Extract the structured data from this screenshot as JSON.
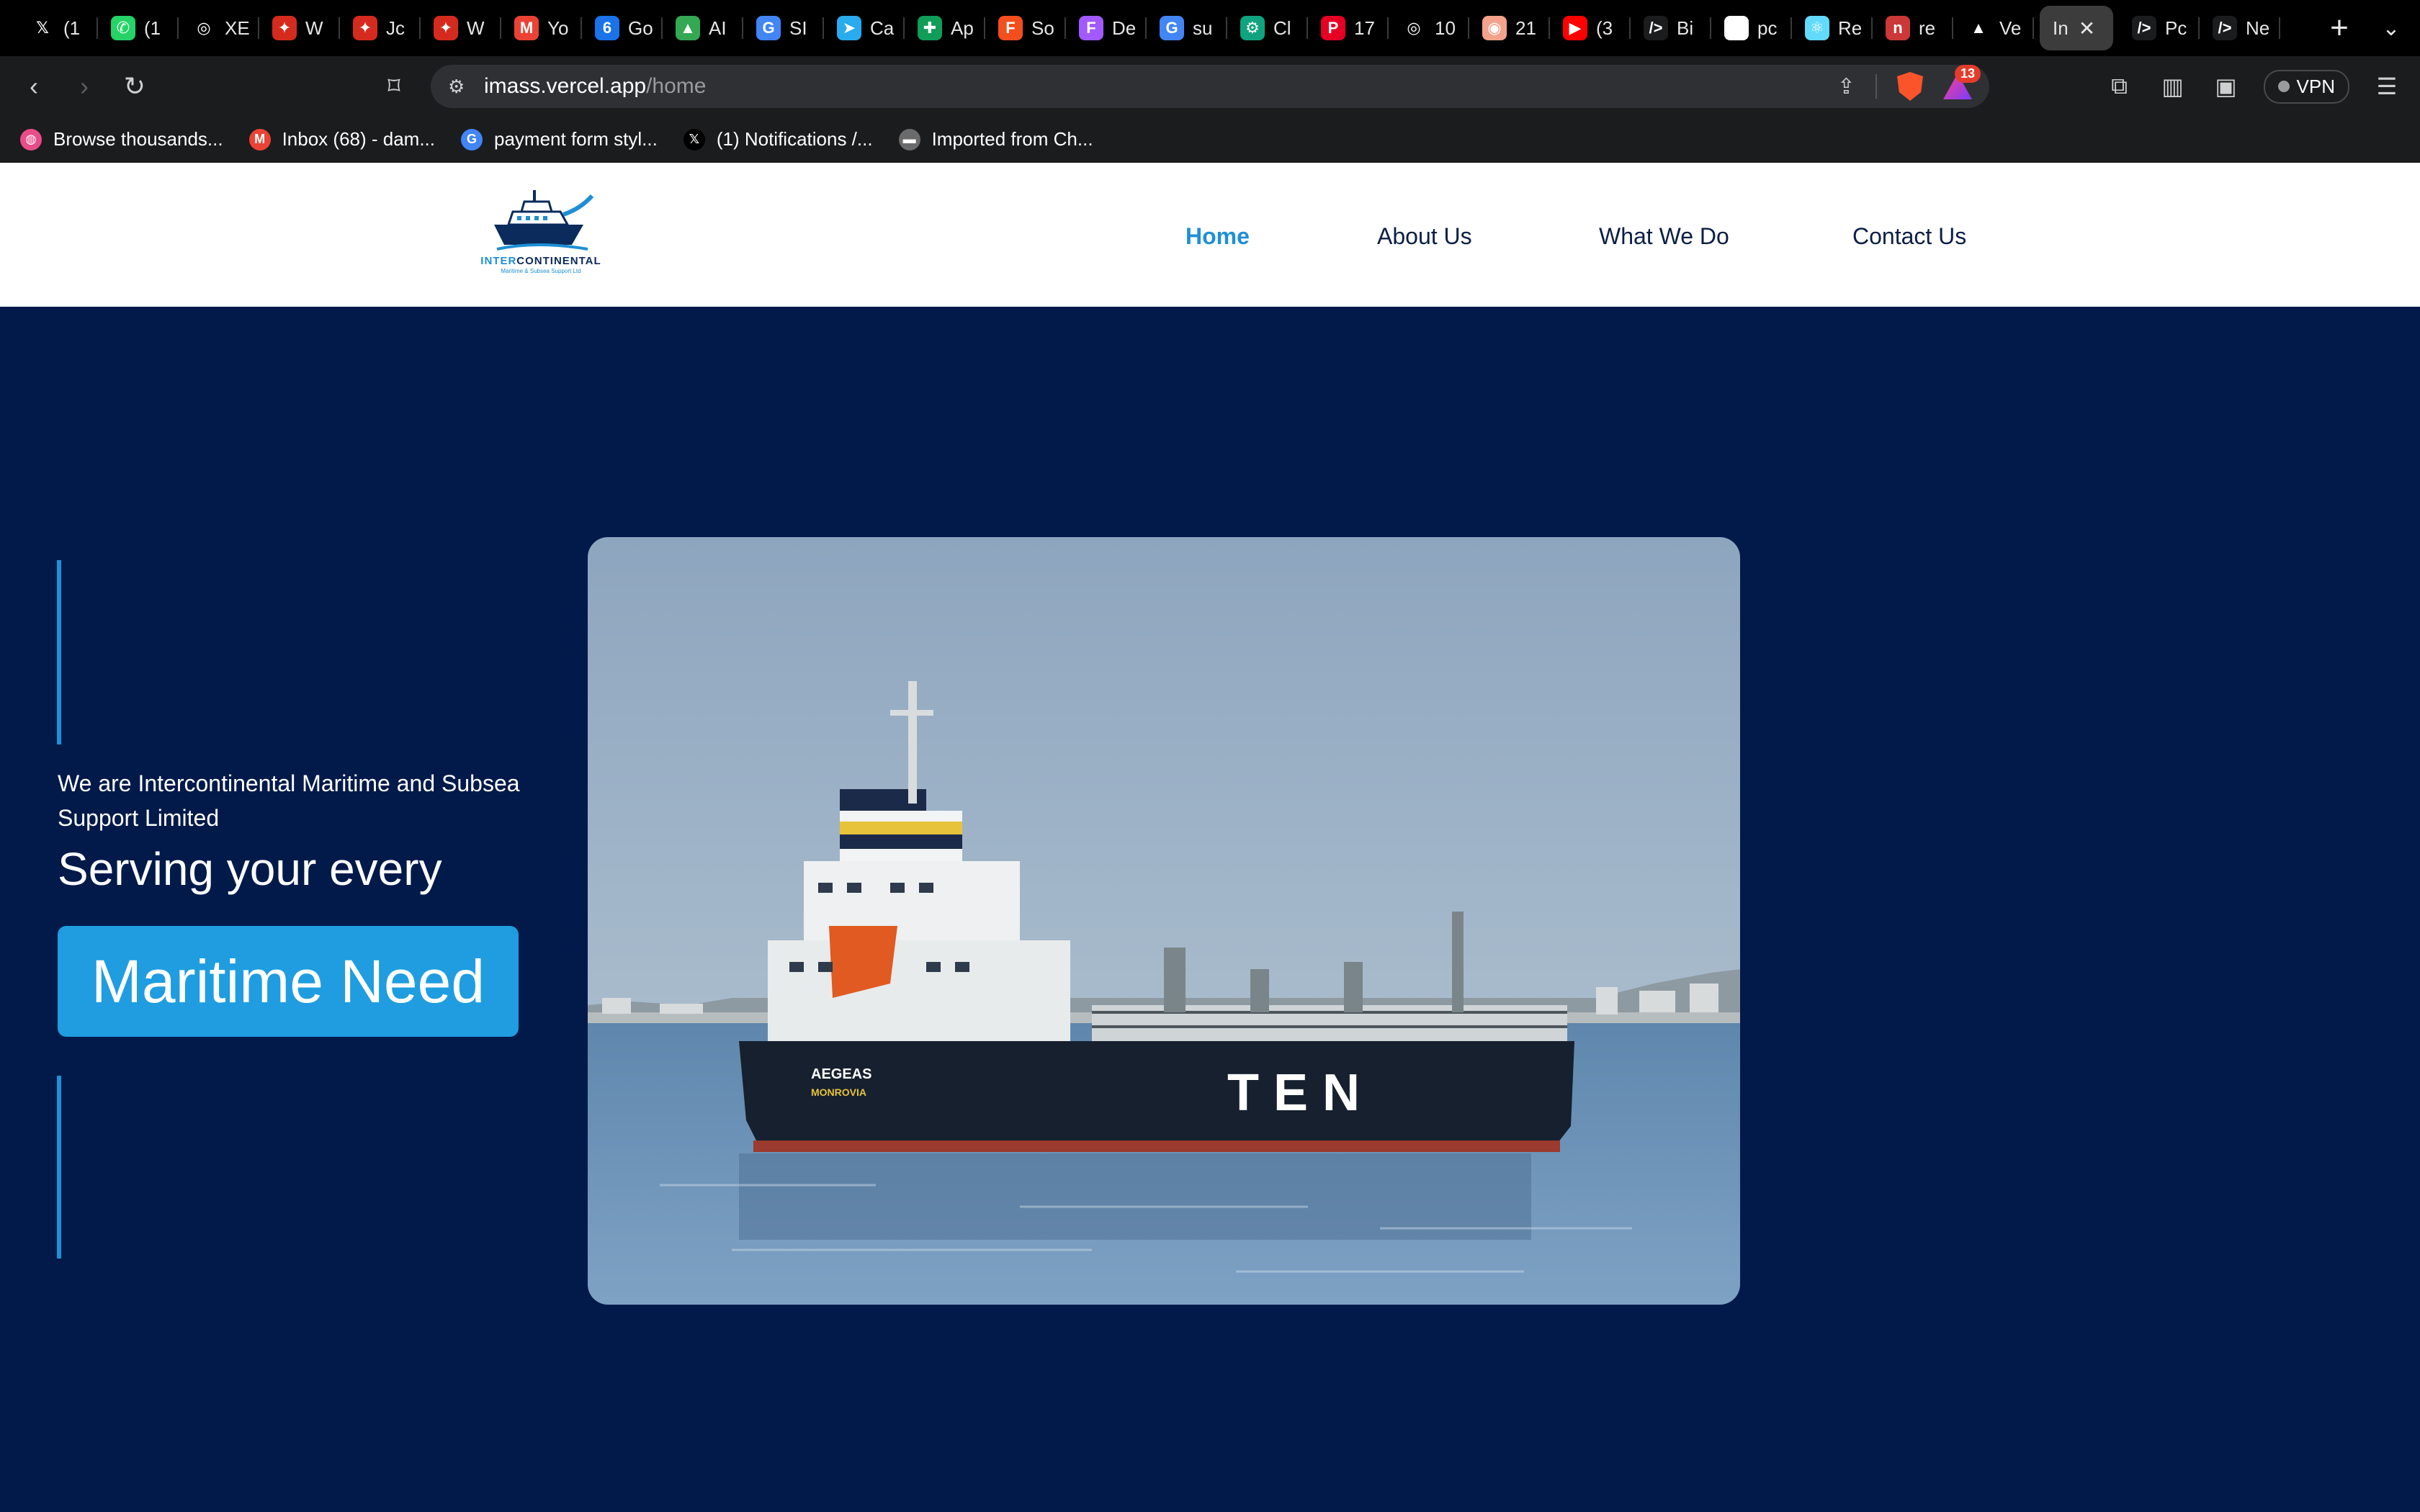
{
  "browser": {
    "tabs": [
      {
        "title": "(1",
        "icon": "x-icon",
        "color": "#000000",
        "glyph": "𝕏"
      },
      {
        "title": "(1",
        "icon": "whatsapp-icon",
        "color": "#25d366",
        "glyph": "✆"
      },
      {
        "title": "XE",
        "icon": "openai-icon",
        "color": "#000000",
        "glyph": "◎"
      },
      {
        "title": "W",
        "icon": "maple-leaf-icon",
        "color": "#d52b1e",
        "glyph": "✦"
      },
      {
        "title": "Jc",
        "icon": "maple-leaf-icon",
        "color": "#d52b1e",
        "glyph": "✦"
      },
      {
        "title": "W",
        "icon": "maple-leaf-icon",
        "color": "#d52b1e",
        "glyph": "✦"
      },
      {
        "title": "Yo",
        "icon": "gmail-icon",
        "color": "#ea4335",
        "glyph": "M"
      },
      {
        "title": "Go",
        "icon": "google-calendar-icon",
        "color": "#1a73e8",
        "glyph": "6"
      },
      {
        "title": "AI",
        "icon": "google-drive-icon",
        "color": "#34a853",
        "glyph": "▲"
      },
      {
        "title": "SI",
        "icon": "google-icon",
        "color": "#4285f4",
        "glyph": "G"
      },
      {
        "title": "Ca",
        "icon": "telegram-icon",
        "color": "#2aabee",
        "glyph": "➤"
      },
      {
        "title": "Ap",
        "icon": "google-sheets-icon",
        "color": "#0f9d58",
        "glyph": "✚"
      },
      {
        "title": "So",
        "icon": "figma-icon",
        "color": "#f24e1e",
        "glyph": "F"
      },
      {
        "title": "De",
        "icon": "figma-icon",
        "color": "#a259ff",
        "glyph": "F"
      },
      {
        "title": "su",
        "icon": "google-icon",
        "color": "#4285f4",
        "glyph": "G"
      },
      {
        "title": "Cl",
        "icon": "chatgpt-icon",
        "color": "#10a37f",
        "glyph": "⚙"
      },
      {
        "title": "17",
        "icon": "pinterest-icon",
        "color": "#e60023",
        "glyph": "P"
      },
      {
        "title": "10",
        "icon": "openai-icon",
        "color": "#000000",
        "glyph": "◎"
      },
      {
        "title": "21",
        "icon": "fingerprint-icon",
        "color": "#f4a28c",
        "glyph": "◉"
      },
      {
        "title": "(3",
        "icon": "youtube-icon",
        "color": "#ff0000",
        "glyph": "▶"
      },
      {
        "title": "Bi",
        "icon": "code-icon",
        "color": "#1b1c1e",
        "glyph": "/>"
      },
      {
        "title": "pc",
        "icon": "github-icon",
        "color": "#ffffff",
        "glyph": "◐"
      },
      {
        "title": "Re",
        "icon": "react-icon",
        "color": "#61dafb",
        "glyph": "⚛"
      },
      {
        "title": "re",
        "icon": "npm-icon",
        "color": "#cb3837",
        "glyph": "n"
      },
      {
        "title": "Ve",
        "icon": "vercel-icon",
        "color": "#000000",
        "glyph": "▲"
      },
      {
        "title": "In",
        "icon": "",
        "color": "#3c3c3c",
        "glyph": "",
        "active": true
      },
      {
        "title": "Pc",
        "icon": "code-icon",
        "color": "#1b1c1e",
        "glyph": "/>"
      },
      {
        "title": "Ne",
        "icon": "code-icon",
        "color": "#1b1c1e",
        "glyph": "/>"
      }
    ],
    "new_tab_glyph": "+",
    "tab_list_glyph": "⌄",
    "url_host": "imass.vercel.app",
    "url_path": "/home",
    "rewards_badge": "13",
    "vpn_label": "VPN",
    "bookmarks": [
      {
        "label": "Browse thousands...",
        "icon": "dribbble-icon",
        "color": "#ea4c89",
        "glyph": "◍"
      },
      {
        "label": "Inbox (68) - dam...",
        "icon": "gmail-icon",
        "color": "#ea4335",
        "glyph": "M"
      },
      {
        "label": "payment form styl...",
        "icon": "google-icon",
        "color": "#4285f4",
        "glyph": "G"
      },
      {
        "label": "(1) Notifications /...",
        "icon": "x-icon",
        "color": "#000000",
        "glyph": "𝕏"
      },
      {
        "label": "Imported from Ch...",
        "icon": "folder-icon",
        "color": "#6b6b6b",
        "glyph": "▬"
      }
    ]
  },
  "site": {
    "logo": {
      "brand_blue": "INTER",
      "brand_dark": "CONTINENTAL",
      "tagline": "Maritime & Subsea Support Ltd"
    },
    "nav": [
      {
        "label": "Home",
        "active": true
      },
      {
        "label": "About Us",
        "active": false
      },
      {
        "label": "What We Do",
        "active": false
      },
      {
        "label": "Contact Us",
        "active": false
      }
    ],
    "hero": {
      "intro": "We are Intercontinental Maritime and Subsea Support Limited",
      "headline": "Serving your every",
      "cta": "Maritime Need"
    },
    "photo": {
      "hull_text": "T E N",
      "name_text": "AEGEAS",
      "port_text": "MONROVIA"
    }
  },
  "colors": {
    "page_bg": "#021a4a",
    "accent": "#1f8fd6",
    "cta_bg": "#1f9de0",
    "header_bg": "#ffffff"
  }
}
